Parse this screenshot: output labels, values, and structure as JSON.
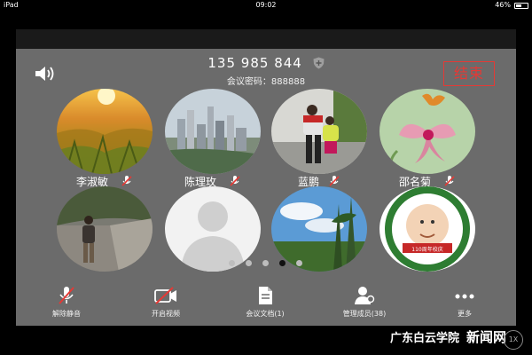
{
  "status_bar": {
    "carrier": "iPad",
    "time": "09:02",
    "battery": "46%"
  },
  "meeting": {
    "id": "135 985 844",
    "password_label": "会议密码：",
    "password": "888888",
    "end_label": "结束"
  },
  "participants": [
    {
      "name": "李淑敏",
      "muted": true
    },
    {
      "name": "陈理玫",
      "muted": true
    },
    {
      "name": "蓝鹏",
      "muted": true
    },
    {
      "name": "邵名菊",
      "muted": true
    },
    {
      "name": "",
      "muted": false
    },
    {
      "name": "",
      "muted": false
    },
    {
      "name": "",
      "muted": false
    },
    {
      "name": "",
      "muted": false,
      "badge_text": "110周年校庆"
    }
  ],
  "pager": {
    "pages": 5,
    "active": 3
  },
  "toolbar": {
    "unmute": "解除静音",
    "video": "开启视频",
    "docs": "会议文档(1)",
    "members": "管理成员(38)",
    "more": "更多"
  },
  "watermark": {
    "text1": "广东白云学院",
    "text2": "新闻网"
  },
  "speed_badge": "1X",
  "colors": {
    "end": "#e53935",
    "panel": "#6b6b6b"
  }
}
